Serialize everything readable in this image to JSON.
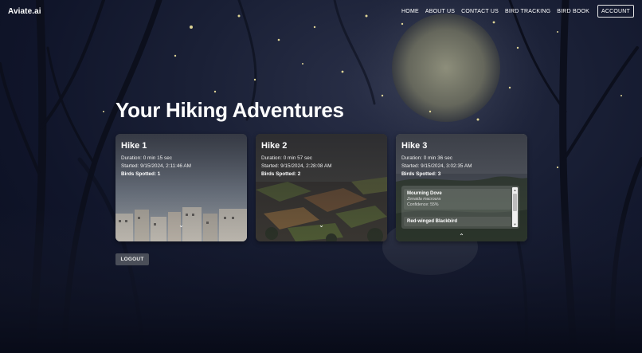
{
  "nav": {
    "brand": "Aviate.ai",
    "links": [
      "HOME",
      "ABOUT US",
      "CONTACT US",
      "BIRD TRACKING",
      "BIRD BOOK"
    ],
    "account": "ACCOUNT"
  },
  "page": {
    "title": "Your Hiking Adventures"
  },
  "hikes": [
    {
      "title": "Hike 1",
      "duration": "Duration: 0 min 15 sec",
      "started": "Started: 9/15/2024, 2:11:46 AM",
      "birds": "Birds Spotted: 1"
    },
    {
      "title": "Hike 2",
      "duration": "Duration: 0 min 57 sec",
      "started": "Started: 9/15/2024, 2:28:08 AM",
      "birds": "Birds Spotted: 2"
    },
    {
      "title": "Hike 3",
      "duration": "Duration: 0 min 36 sec",
      "started": "Started: 9/15/2024, 3:02:35 AM",
      "birds": "Birds Spotted: 3",
      "bird_list": [
        {
          "name": "Mourning Dove",
          "scientific": "Zenaida macroura",
          "confidence": "Confidence: 55%"
        },
        {
          "name": "Red-winged Blackbird"
        }
      ]
    }
  ],
  "logout": "LOGOUT",
  "icons": {
    "collapse": "chevron-down-icon",
    "expand": "chevron-up-icon"
  }
}
